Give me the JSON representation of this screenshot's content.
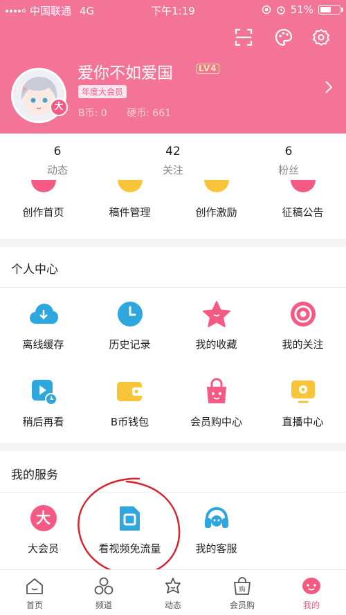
{
  "status": {
    "carrier": "中国联通",
    "network": "4G",
    "time": "下午1:19",
    "battery": "51%"
  },
  "profile": {
    "name": "爱你不如爱国",
    "level": "LV4",
    "vip": "年度大会员",
    "avatar_badge": "大",
    "bcoin": "B币: 0",
    "coin": "硬币: 661"
  },
  "stats": [
    {
      "num": "6",
      "label": "动态"
    },
    {
      "num": "42",
      "label": "关注"
    },
    {
      "num": "6",
      "label": "粉丝"
    }
  ],
  "creator": [
    {
      "label": "创作首页"
    },
    {
      "label": "稿件管理"
    },
    {
      "label": "创作激励"
    },
    {
      "label": "征稿公告"
    }
  ],
  "personal": {
    "title": "个人中心",
    "items": [
      {
        "label": "离线缓存"
      },
      {
        "label": "历史记录"
      },
      {
        "label": "我的收藏"
      },
      {
        "label": "我的关注"
      },
      {
        "label": "稍后再看"
      },
      {
        "label": "B币钱包"
      },
      {
        "label": "会员购中心"
      },
      {
        "label": "直播中心"
      }
    ]
  },
  "services": {
    "title": "我的服务",
    "items": [
      {
        "label": "大会员",
        "glyph": "大"
      },
      {
        "label": "看视频免流量"
      },
      {
        "label": "我的客服"
      }
    ]
  },
  "tabs": [
    {
      "label": "首页"
    },
    {
      "label": "频道"
    },
    {
      "label": "动态"
    },
    {
      "label": "会员购",
      "glyph": "购"
    },
    {
      "label": "我的"
    }
  ],
  "colors": {
    "brand": "#f47497",
    "accent": "#f45a84",
    "blue": "#2ea6de",
    "yellow": "#f8c53a"
  }
}
